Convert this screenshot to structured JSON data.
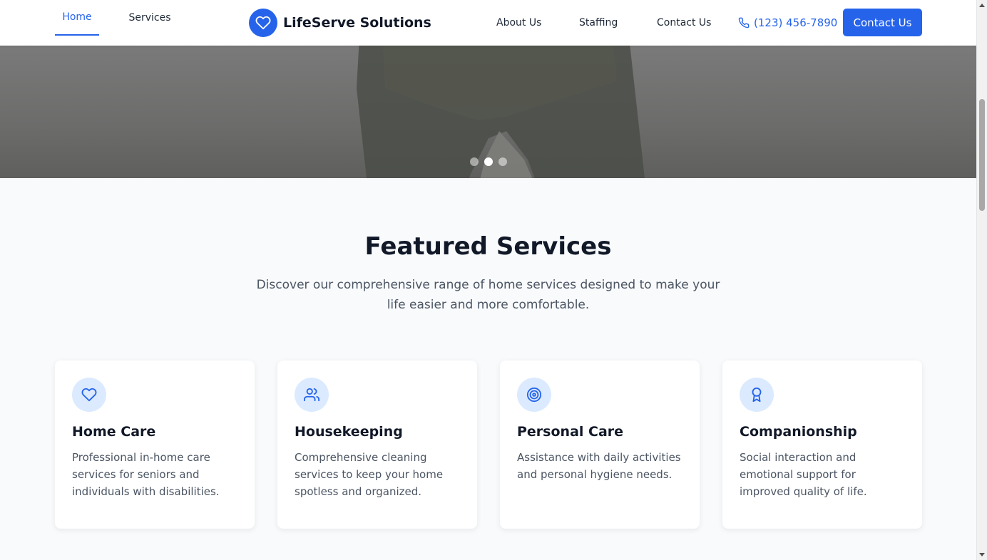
{
  "nav": {
    "home": "Home",
    "services": "Services",
    "brand_name": "LifeServe Solutions",
    "about": "About Us",
    "staffing": "Staffing",
    "contact": "Contact Us",
    "phone": "(123) 456-7890",
    "cta": "Contact Us"
  },
  "hero": {
    "slides": 3,
    "active_slide": 2
  },
  "featured": {
    "title": "Featured Services",
    "subtitle": "Discover our comprehensive range of home services designed to make your life easier and more comfortable.",
    "cards": [
      {
        "icon": "heart-icon",
        "title": "Home Care",
        "description": "Professional in-home care services for seniors and individuals with disabilities."
      },
      {
        "icon": "users-icon",
        "title": "Housekeeping",
        "description": "Comprehensive cleaning services to keep your home spotless and organized."
      },
      {
        "icon": "target-icon",
        "title": "Personal Care",
        "description": "Assistance with daily activities and personal hygiene needs."
      },
      {
        "icon": "award-icon",
        "title": "Companionship",
        "description": "Social interaction and emotional support for improved quality of life."
      }
    ]
  },
  "colors": {
    "primary": "#2563eb",
    "icon_bg": "#dbeafe",
    "page_bg": "#f8fafc"
  }
}
